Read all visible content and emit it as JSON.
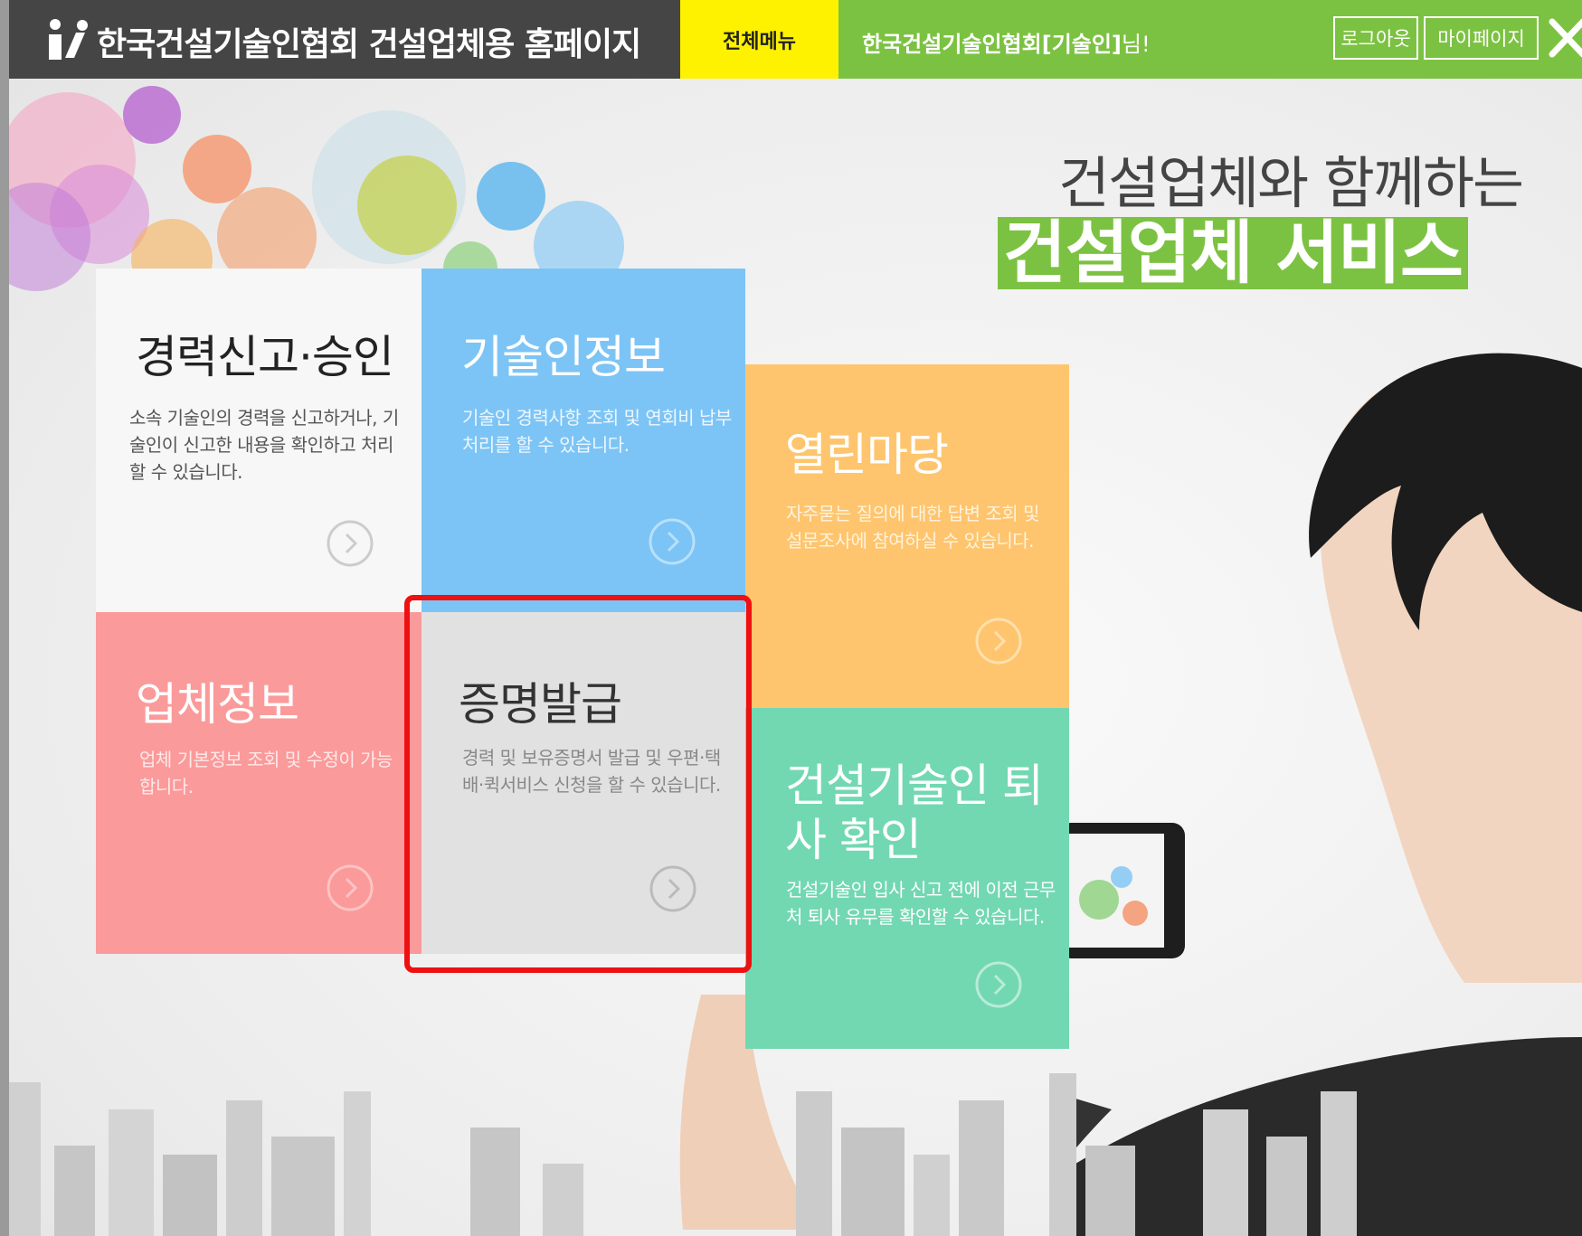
{
  "header": {
    "title": "한국건설기술인협회 건설업체용 홈페이지",
    "menu_label": "전체메뉴",
    "user_name": "한국건설기술인협회[기술인]",
    "user_suffix": "님!",
    "logout_label": "로그아웃",
    "mypage_label": "마이페이지"
  },
  "hero": {
    "subtitle": "건설업체와 함께하는",
    "title": "건설업체 서비스"
  },
  "tiles": [
    {
      "title": "경력신고·승인",
      "desc": "소속 기술인의 경력을 신고하거나, 기술인이 신고한 내용을 확인하고 처리할 수 있습니다."
    },
    {
      "title": "기술인정보",
      "desc": "기술인 경력사항 조회 및 연회비 납부 처리를 할 수 있습니다."
    },
    {
      "title": "업체정보",
      "desc": "업체 기본정보 조회 및 수정이 가능합니다."
    },
    {
      "title": "증명발급",
      "desc": "경력 및 보유증명서 발급 및 우편·택배·퀵서비스 신청을 할 수 있습니다."
    },
    {
      "title": "열린마당",
      "desc": "자주묻는 질의에 대한 답변 조회 및 설문조사에 참여하실 수 있습니다."
    },
    {
      "title": "건설기술인 퇴사 확인",
      "desc": "건설기술인 입사 신고 전에 이전 근무처 퇴사 유무를 확인할 수 있습니다."
    }
  ],
  "colors": {
    "brand_dark": "#454545",
    "menu_yellow": "#fff200",
    "accent_green": "#7cc242",
    "tile_white": "#f7f7f7",
    "tile_blue": "#7cc4f5",
    "tile_pink": "#fb9a9a",
    "tile_gray": "#e1e1e1",
    "tile_orange": "#fec56e",
    "tile_mint": "#72d8b1",
    "highlight_red": "#ee1111"
  },
  "icons": [
    "brand-logo-icon",
    "close-icon",
    "chevron-right-circle-icon"
  ]
}
